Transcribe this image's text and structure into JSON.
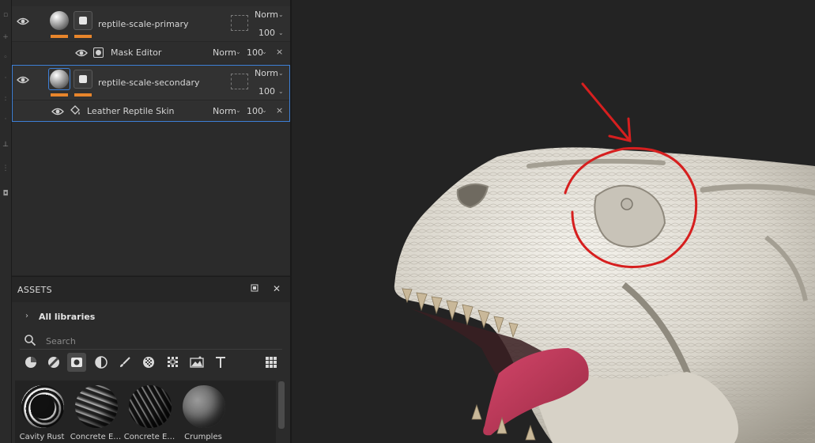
{
  "layers": {
    "primary": {
      "name": "reptile-scale-primary",
      "blend": "Norm",
      "opacity": "100",
      "mask_row": {
        "name": "Mask Editor",
        "blend": "Norm",
        "opacity": "100",
        "close": "×"
      }
    },
    "secondary": {
      "name": "reptile-scale-secondary",
      "blend": "Norm",
      "opacity": "100",
      "sub_row": {
        "name": "Leather Reptile Skin",
        "blend": "Norm",
        "opacity": "100",
        "close": "×"
      }
    }
  },
  "assets": {
    "title": "ASSETS",
    "libraries_label": "All libraries",
    "search_placeholder": "Search",
    "filters": [
      "all-materials",
      "smart-materials",
      "masks",
      "procedurals",
      "brushes",
      "textures",
      "alphas",
      "environments",
      "fonts"
    ],
    "tiles": [
      {
        "label": "Cavity Rust"
      },
      {
        "label": "Concrete E…"
      },
      {
        "label": "Concrete E…"
      },
      {
        "label": "Crumples"
      }
    ]
  },
  "colors": {
    "accent_blue": "#3d7fd6",
    "orange_marker": "#e8852b",
    "annotation_red": "#d61f1f",
    "tongue": "#c43a58"
  }
}
